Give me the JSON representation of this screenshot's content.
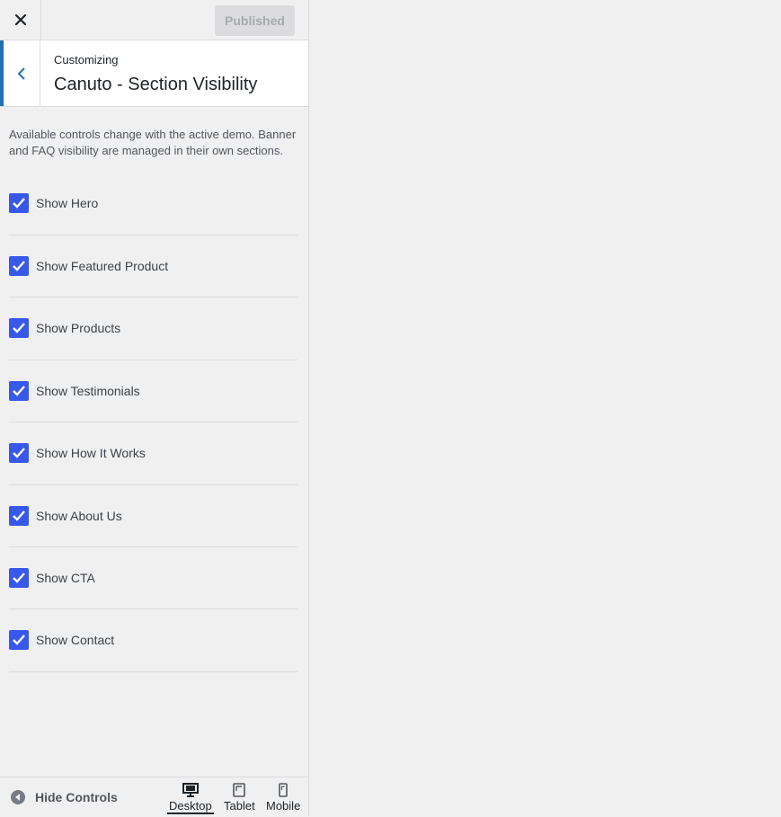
{
  "header": {
    "publish_label": "Published"
  },
  "section": {
    "breadcrumb": "Customizing",
    "title": "Canuto - Section Visibility",
    "description": "Available controls change with the active demo. Banner and FAQ visibility are managed in their own sections."
  },
  "controls": [
    {
      "label": "Show Hero",
      "checked": true
    },
    {
      "label": "Show Featured Product",
      "checked": true
    },
    {
      "label": "Show Products",
      "checked": true
    },
    {
      "label": "Show Testimonials",
      "checked": true
    },
    {
      "label": "Show How It Works",
      "checked": true
    },
    {
      "label": "Show About Us",
      "checked": true
    },
    {
      "label": "Show CTA",
      "checked": true
    },
    {
      "label": "Show Contact",
      "checked": true
    }
  ],
  "footer": {
    "hide_controls_label": "Hide Controls",
    "devices": [
      {
        "label": "Desktop",
        "icon": "desktop-icon",
        "active": true
      },
      {
        "label": "Tablet",
        "icon": "tablet-icon",
        "active": false
      },
      {
        "label": "Mobile",
        "icon": "mobile-icon",
        "active": false
      }
    ]
  },
  "colors": {
    "accent": "#3858e9",
    "back_bar": "#2271b1"
  }
}
